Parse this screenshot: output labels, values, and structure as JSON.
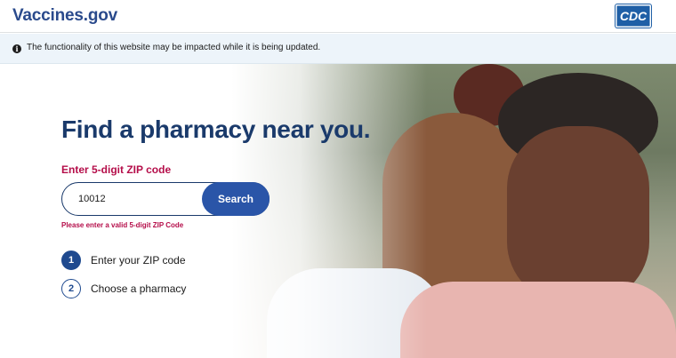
{
  "header": {
    "logo": "Vaccines.gov",
    "partner_logo": "CDC"
  },
  "alert": {
    "message": "The functionality of this website may be impacted while it is being updated."
  },
  "hero": {
    "title": "Find a pharmacy near you.",
    "zip_label": "Enter 5-digit ZIP code",
    "zip_value": "10012",
    "search_label": "Search",
    "error": "Please enter a valid 5-digit ZIP Code",
    "steps": [
      {
        "number": "1",
        "label": "Enter your ZIP code"
      },
      {
        "number": "2",
        "label": "Choose a pharmacy"
      }
    ]
  },
  "colors": {
    "brand_navy": "#1a3a6b",
    "accent_blue": "#2a55a8",
    "error_red": "#b50e4a",
    "alert_bg": "#edf4fa"
  }
}
